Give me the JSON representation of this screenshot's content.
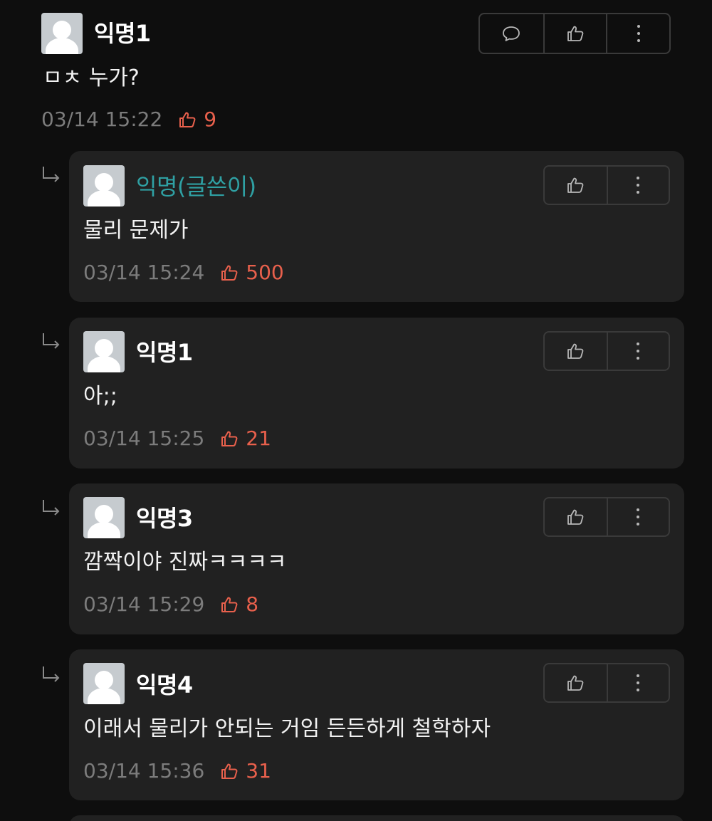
{
  "top_comment": {
    "author": "익명1",
    "text": "ㅁㅊ 누가?",
    "time": "03/14 15:22",
    "likes": "9",
    "actions": [
      "comment-icon",
      "thumbs-up-icon",
      "more-vertical-icon"
    ]
  },
  "replies": [
    {
      "author": "익명(글쓴이)",
      "is_op": true,
      "text": "물리 문제가",
      "time": "03/14 15:24",
      "likes": "500"
    },
    {
      "author": "익명1",
      "is_op": false,
      "text": "아;;",
      "time": "03/14 15:25",
      "likes": "21"
    },
    {
      "author": "익명3",
      "is_op": false,
      "text": "깜짝이야 진짜ㅋㅋㅋㅋ",
      "time": "03/14 15:29",
      "likes": "8"
    },
    {
      "author": "익명4",
      "is_op": false,
      "text": "이래서 물리가 안되는 거임 든든하게 철학하자",
      "time": "03/14 15:36",
      "likes": "31"
    }
  ],
  "colors": {
    "background": "#0e0e0e",
    "card": "#212121",
    "op_author": "#2fa0a3",
    "like_accent": "#e8604c",
    "timestamp": "#7c7c7c"
  }
}
